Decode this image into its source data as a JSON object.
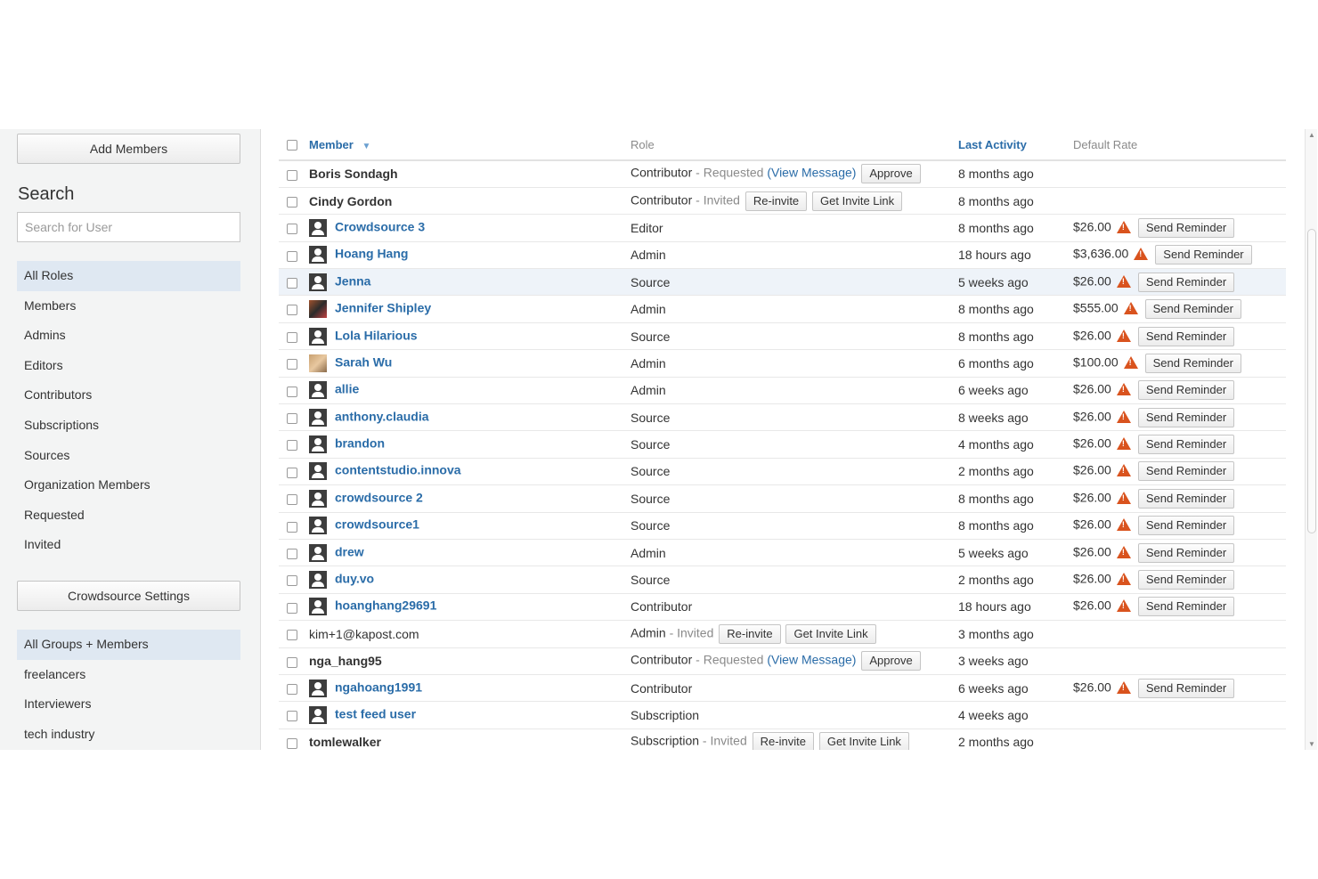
{
  "sidebar": {
    "add_members": "Add Members",
    "search_title": "Search",
    "search_placeholder": "Search for User",
    "roles": [
      "All Roles",
      "Members",
      "Admins",
      "Editors",
      "Contributors",
      "Subscriptions",
      "Sources",
      "Organization Members",
      "Requested",
      "Invited"
    ],
    "crowdsource_settings": "Crowdsource Settings",
    "groups": [
      "All Groups + Members",
      "freelancers",
      "Interviewers",
      "tech industry"
    ]
  },
  "table": {
    "headers": {
      "member": "Member",
      "sort_arrow": "▼",
      "role": "Role",
      "last_activity": "Last Activity",
      "default_rate": "Default Rate"
    },
    "rows": [
      {
        "name": "Boris Sondagh",
        "name_style": "plain",
        "avatar": "none",
        "role": "Contributor",
        "status": " - Requested ",
        "view_message": "(View Message)",
        "buttons": [
          "Approve"
        ],
        "activity": "8 months ago",
        "rate": "",
        "reminder": ""
      },
      {
        "name": "Cindy Gordon",
        "name_style": "plain",
        "avatar": "none",
        "role": "Contributor",
        "status": " - Invited ",
        "view_message": "",
        "buttons": [
          "Re-invite",
          "Get Invite Link"
        ],
        "activity": "8 months ago",
        "rate": "",
        "reminder": ""
      },
      {
        "name": "Crowdsource 3",
        "name_style": "link",
        "avatar": "generic",
        "role": "Editor",
        "status": "",
        "view_message": "",
        "buttons": [],
        "activity": "8 months ago",
        "rate": "$26.00",
        "reminder": "Send Reminder"
      },
      {
        "name": "Hoang Hang",
        "name_style": "link",
        "avatar": "generic",
        "role": "Admin",
        "status": "",
        "view_message": "",
        "buttons": [],
        "activity": "18 hours ago",
        "rate": "$3,636.00",
        "reminder": "Send Reminder"
      },
      {
        "name": "Jenna",
        "name_style": "link",
        "avatar": "generic",
        "role": "Source",
        "status": "",
        "view_message": "",
        "buttons": [],
        "activity": "5 weeks ago",
        "rate": "$26.00",
        "reminder": "Send Reminder",
        "highlight": true
      },
      {
        "name": "Jennifer Shipley",
        "name_style": "link",
        "avatar": "photo1",
        "role": "Admin",
        "status": "",
        "view_message": "",
        "buttons": [],
        "activity": "8 months ago",
        "rate": "$555.00",
        "reminder": "Send Reminder"
      },
      {
        "name": "Lola Hilarious",
        "name_style": "link",
        "avatar": "generic",
        "role": "Source",
        "status": "",
        "view_message": "",
        "buttons": [],
        "activity": "8 months ago",
        "rate": "$26.00",
        "reminder": "Send Reminder"
      },
      {
        "name": "Sarah Wu",
        "name_style": "link",
        "avatar": "photo2",
        "role": "Admin",
        "status": "",
        "view_message": "",
        "buttons": [],
        "activity": "6 months ago",
        "rate": "$100.00",
        "reminder": "Send Reminder"
      },
      {
        "name": "allie",
        "name_style": "link",
        "avatar": "generic",
        "role": "Admin",
        "status": "",
        "view_message": "",
        "buttons": [],
        "activity": "6 weeks ago",
        "rate": "$26.00",
        "reminder": "Send Reminder"
      },
      {
        "name": "anthony.claudia",
        "name_style": "link",
        "avatar": "generic",
        "role": "Source",
        "status": "",
        "view_message": "",
        "buttons": [],
        "activity": "8 weeks ago",
        "rate": "$26.00",
        "reminder": "Send Reminder"
      },
      {
        "name": "brandon",
        "name_style": "link",
        "avatar": "generic",
        "role": "Source",
        "status": "",
        "view_message": "",
        "buttons": [],
        "activity": "4 months ago",
        "rate": "$26.00",
        "reminder": "Send Reminder"
      },
      {
        "name": "contentstudio.innova",
        "name_style": "link",
        "avatar": "generic",
        "role": "Source",
        "status": "",
        "view_message": "",
        "buttons": [],
        "activity": "2 months ago",
        "rate": "$26.00",
        "reminder": "Send Reminder"
      },
      {
        "name": "crowdsource 2",
        "name_style": "link",
        "avatar": "generic",
        "role": "Source",
        "status": "",
        "view_message": "",
        "buttons": [],
        "activity": "8 months ago",
        "rate": "$26.00",
        "reminder": "Send Reminder"
      },
      {
        "name": "crowdsource1",
        "name_style": "link",
        "avatar": "generic",
        "role": "Source",
        "status": "",
        "view_message": "",
        "buttons": [],
        "activity": "8 months ago",
        "rate": "$26.00",
        "reminder": "Send Reminder"
      },
      {
        "name": "drew",
        "name_style": "link",
        "avatar": "generic",
        "role": "Admin",
        "status": "",
        "view_message": "",
        "buttons": [],
        "activity": "5 weeks ago",
        "rate": "$26.00",
        "reminder": "Send Reminder"
      },
      {
        "name": "duy.vo",
        "name_style": "link",
        "avatar": "generic",
        "role": "Source",
        "status": "",
        "view_message": "",
        "buttons": [],
        "activity": "2 months ago",
        "rate": "$26.00",
        "reminder": "Send Reminder"
      },
      {
        "name": "hoanghang29691",
        "name_style": "link",
        "avatar": "generic",
        "role": "Contributor",
        "status": "",
        "view_message": "",
        "buttons": [],
        "activity": "18 hours ago",
        "rate": "$26.00",
        "reminder": "Send Reminder"
      },
      {
        "name": "kim+1@kapost.com",
        "name_style": "email",
        "avatar": "none",
        "role": "Admin",
        "status": " - Invited ",
        "view_message": "",
        "buttons": [
          "Re-invite",
          "Get Invite Link"
        ],
        "activity": "3 months ago",
        "rate": "",
        "reminder": ""
      },
      {
        "name": "nga_hang95",
        "name_style": "plain",
        "avatar": "none",
        "role": "Contributor",
        "status": " - Requested ",
        "view_message": "(View Message)",
        "buttons": [
          "Approve"
        ],
        "activity": "3 weeks ago",
        "rate": "",
        "reminder": ""
      },
      {
        "name": "ngahoang1991",
        "name_style": "link",
        "avatar": "generic",
        "role": "Contributor",
        "status": "",
        "view_message": "",
        "buttons": [],
        "activity": "6 weeks ago",
        "rate": "$26.00",
        "reminder": "Send Reminder"
      },
      {
        "name": "test feed user",
        "name_style": "link",
        "avatar": "generic",
        "role": "Subscription",
        "status": "",
        "view_message": "",
        "buttons": [],
        "activity": "4 weeks ago",
        "rate": "",
        "reminder": ""
      },
      {
        "name": "tomlewalker",
        "name_style": "plain",
        "avatar": "none",
        "role": "Subscription",
        "status": " - Invited ",
        "view_message": "",
        "buttons": [
          "Re-invite",
          "Get Invite Link"
        ],
        "activity": "2 months ago",
        "rate": "",
        "reminder": ""
      }
    ]
  },
  "colors": {
    "link": "#2a6ca8",
    "warning": "#d9531e",
    "sidebar_bg": "#f3f4f4",
    "active_bg": "#dfe8f2"
  },
  "icons": {
    "warning": "warning-triangle-icon",
    "avatar": "user-avatar-icon",
    "sort": "sort-desc-icon"
  }
}
